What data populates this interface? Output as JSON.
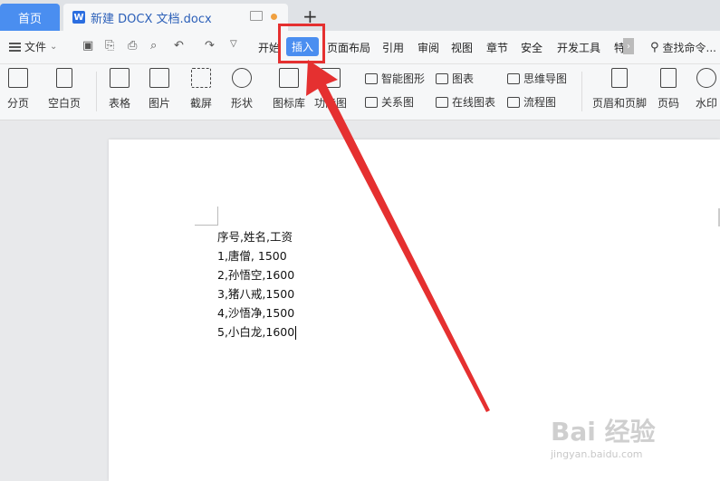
{
  "tabs": {
    "home": "首页",
    "document": "新建 DOCX 文档.docx",
    "add": "+"
  },
  "menubar": {
    "file": "文件",
    "tabs": [
      "开始",
      "插入",
      "页面布局",
      "引用",
      "审阅",
      "视图",
      "章节",
      "安全",
      "开发工具",
      "特"
    ],
    "active_tab": "插入",
    "search": "查找命令..."
  },
  "ribbon": {
    "page_break": "分页",
    "blank_page": "空白页",
    "table": "表格",
    "picture": "图片",
    "screenshot": "截屏",
    "shapes": "形状",
    "icon_lib": "图标库",
    "function_chart": "功能图",
    "smart_graphic": "智能图形",
    "chart": "图表",
    "mind_map": "思维导图",
    "relation": "关系图",
    "online_chart": "在线图表",
    "flowchart": "流程图",
    "header_footer": "页眉和页脚",
    "page_number": "页码",
    "watermark": "水印"
  },
  "document": {
    "lines": [
      "序号,姓名,工资",
      "1,唐僧, 1500",
      "2,孙悟空,1600",
      "3,猪八戒,1500",
      "4,沙悟净,1500",
      "5,小白龙,1600"
    ]
  },
  "watermark": {
    "logo": "Bai 经验",
    "url": "jingyan.baidu.com"
  },
  "colors": {
    "accent": "#4a8ef0",
    "annotation": "#e53030"
  }
}
